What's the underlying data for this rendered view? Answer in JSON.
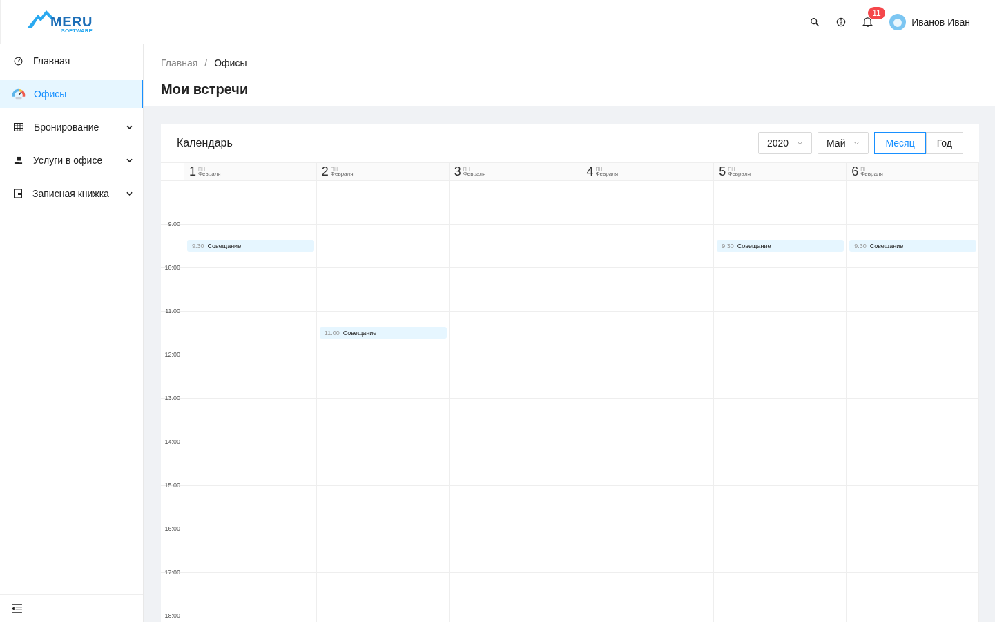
{
  "logo": {
    "name": "MERU",
    "sub": "SOFTWARE"
  },
  "header": {
    "notifications": "11",
    "user": "Иванов Иван"
  },
  "sidebar": {
    "items": [
      {
        "label": "Главная",
        "selected": false,
        "expandable": false
      },
      {
        "label": "Офисы",
        "selected": true,
        "expandable": false
      },
      {
        "label": "Бронирование",
        "selected": false,
        "expandable": true
      },
      {
        "label": "Услуги в офисе",
        "selected": false,
        "expandable": true
      },
      {
        "label": "Записная книжка",
        "selected": false,
        "expandable": true
      }
    ]
  },
  "breadcrumbs": [
    "Главная",
    "Офисы"
  ],
  "breadcrumb_separator": "/",
  "page_title": "Мои встречи",
  "calendar": {
    "title": "Календарь",
    "year": "2020",
    "month": "Май",
    "views": [
      {
        "label": "Месяц",
        "selected": true
      },
      {
        "label": "Год",
        "selected": false
      }
    ],
    "days": [
      {
        "number": "1",
        "weekday": "ПН",
        "month": "Февраля"
      },
      {
        "number": "2",
        "weekday": "ПН",
        "month": "Февраля"
      },
      {
        "number": "3",
        "weekday": "ПН",
        "month": "Февраля"
      },
      {
        "number": "4",
        "weekday": "ПН",
        "month": "Февраля"
      },
      {
        "number": "5",
        "weekday": "ПН",
        "month": "Февраля"
      },
      {
        "number": "6",
        "weekday": "ПН",
        "month": "Февраля"
      }
    ],
    "rows": [
      {
        "cells": [
          null,
          null,
          null,
          null,
          null,
          null
        ]
      },
      {
        "time": "9:00",
        "cells": [
          {
            "time": "9:30",
            "title": "Совещание"
          },
          null,
          null,
          null,
          {
            "time": "9:30",
            "title": "Совещание"
          },
          {
            "time": "9:30",
            "title": "Совещание"
          }
        ]
      },
      {
        "time": "10:00",
        "cells": [
          null,
          null,
          null,
          null,
          null,
          null
        ]
      },
      {
        "time": "11:00",
        "cells": [
          null,
          {
            "time": "11:00",
            "title": "Совещание"
          },
          null,
          null,
          null,
          null
        ]
      },
      {
        "time": "12:00",
        "cells": [
          null,
          null,
          null,
          null,
          null,
          null
        ]
      },
      {
        "time": "13:00",
        "cells": [
          null,
          null,
          null,
          null,
          null,
          null
        ]
      },
      {
        "time": "14:00",
        "cells": [
          null,
          null,
          null,
          null,
          null,
          null
        ]
      },
      {
        "time": "15:00",
        "cells": [
          null,
          null,
          null,
          null,
          null,
          null
        ]
      },
      {
        "time": "16:00",
        "cells": [
          null,
          null,
          null,
          null,
          null,
          null
        ]
      },
      {
        "time": "17:00",
        "cells": [
          null,
          null,
          null,
          null,
          null,
          null
        ]
      },
      {
        "time": "18:00",
        "cells": [
          null,
          null,
          null,
          null,
          null,
          null
        ]
      }
    ]
  }
}
